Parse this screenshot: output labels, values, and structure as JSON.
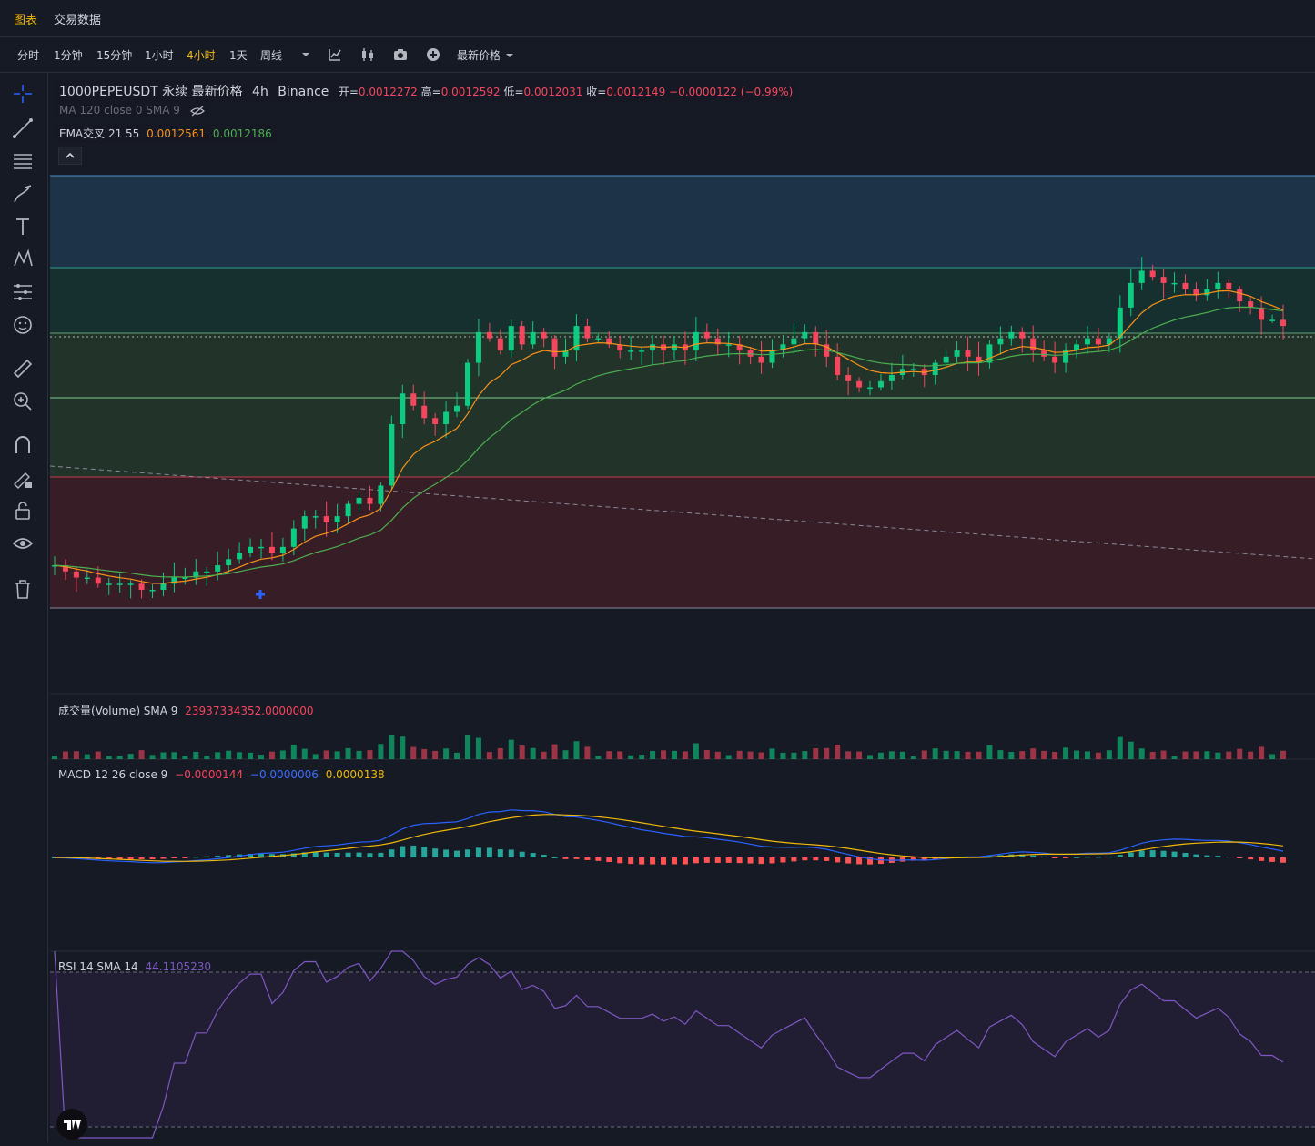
{
  "top_tabs": [
    "图表",
    "交易数据"
  ],
  "timeframes": [
    "分时",
    "1分钟",
    "15分钟",
    "1小时",
    "4小时",
    "1天",
    "周线"
  ],
  "active_timeframe": "4小时",
  "price_type": "最新价格",
  "legend": {
    "symbol": "1000PEPEUSDT 永续 最新价格",
    "interval": "4h",
    "exchange": "Binance",
    "open_label": "开=",
    "open": "0.0012272",
    "high_label": "高=",
    "high": "0.0012592",
    "low_label": "低=",
    "low": "0.0012031",
    "close_label": "收=",
    "close": "0.0012149",
    "change": "−0.0000122 (−0.99%)"
  },
  "ma_legend": "MA 120 close 0 SMA 9",
  "ema_legend": {
    "label": "EMA交叉 21 55",
    "v1": "0.0012561",
    "v2": "0.0012186"
  },
  "volume_legend": {
    "label": "成交量(Volume) SMA 9",
    "value": "23937334352.0000000"
  },
  "macd_legend": {
    "label": "MACD 12 26 close 9",
    "hist": "−0.0000144",
    "macd": "−0.0000006",
    "signal": "0.0000138"
  },
  "rsi_legend": {
    "label": "RSI 14 SMA 14",
    "value": "44.1105230"
  },
  "colors": {
    "up": "#0ECB81",
    "down": "#F6465D",
    "ema21": "#F7931A",
    "ema55": "#4CAF50",
    "macd": "#2962FF",
    "signal": "#F0B90B",
    "rsi": "#7E57C2"
  },
  "zones": [
    {
      "color": "#1E3A4F",
      "label": "blue zone"
    },
    {
      "color": "#163532",
      "label": "teal zone"
    },
    {
      "color": "#25382A",
      "label": "green zone"
    },
    {
      "color": "#3D1F26",
      "label": "red zone"
    }
  ],
  "price_series": [
    0.00082,
    0.00081,
    0.0008,
    0.0008,
    0.00079,
    0.00079,
    0.00079,
    0.00079,
    0.00078,
    0.00078,
    0.00079,
    0.0008,
    0.0008,
    0.00081,
    0.00081,
    0.00082,
    0.00083,
    0.00084,
    0.00085,
    0.00085,
    0.00084,
    0.00085,
    0.00088,
    0.0009,
    0.0009,
    0.00089,
    0.0009,
    0.00092,
    0.00093,
    0.00092,
    0.00095,
    0.00105,
    0.0011,
    0.00108,
    0.00106,
    0.00105,
    0.00107,
    0.00108,
    0.00115,
    0.0012,
    0.00119,
    0.00117,
    0.00121,
    0.00118,
    0.0012,
    0.00119,
    0.00116,
    0.00117,
    0.00121,
    0.00119,
    0.00119,
    0.00118,
    0.00117,
    0.00117,
    0.00117,
    0.00118,
    0.00117,
    0.00118,
    0.00117,
    0.0012,
    0.00119,
    0.00118,
    0.00118,
    0.00117,
    0.00116,
    0.00115,
    0.00117,
    0.00118,
    0.00119,
    0.0012,
    0.00118,
    0.00116,
    0.00113,
    0.00112,
    0.00111,
    0.00111,
    0.00112,
    0.00113,
    0.00114,
    0.00114,
    0.00113,
    0.00115,
    0.00116,
    0.00117,
    0.00116,
    0.00115,
    0.00118,
    0.00119,
    0.0012,
    0.00119,
    0.00117,
    0.00116,
    0.00115,
    0.00117,
    0.00118,
    0.00119,
    0.00118,
    0.00119,
    0.00124,
    0.00128,
    0.0013,
    0.00129,
    0.00128,
    0.00128,
    0.00127,
    0.00126,
    0.00127,
    0.00128,
    0.00127,
    0.00125,
    0.00124,
    0.00122,
    0.00122,
    0.00121
  ]
}
